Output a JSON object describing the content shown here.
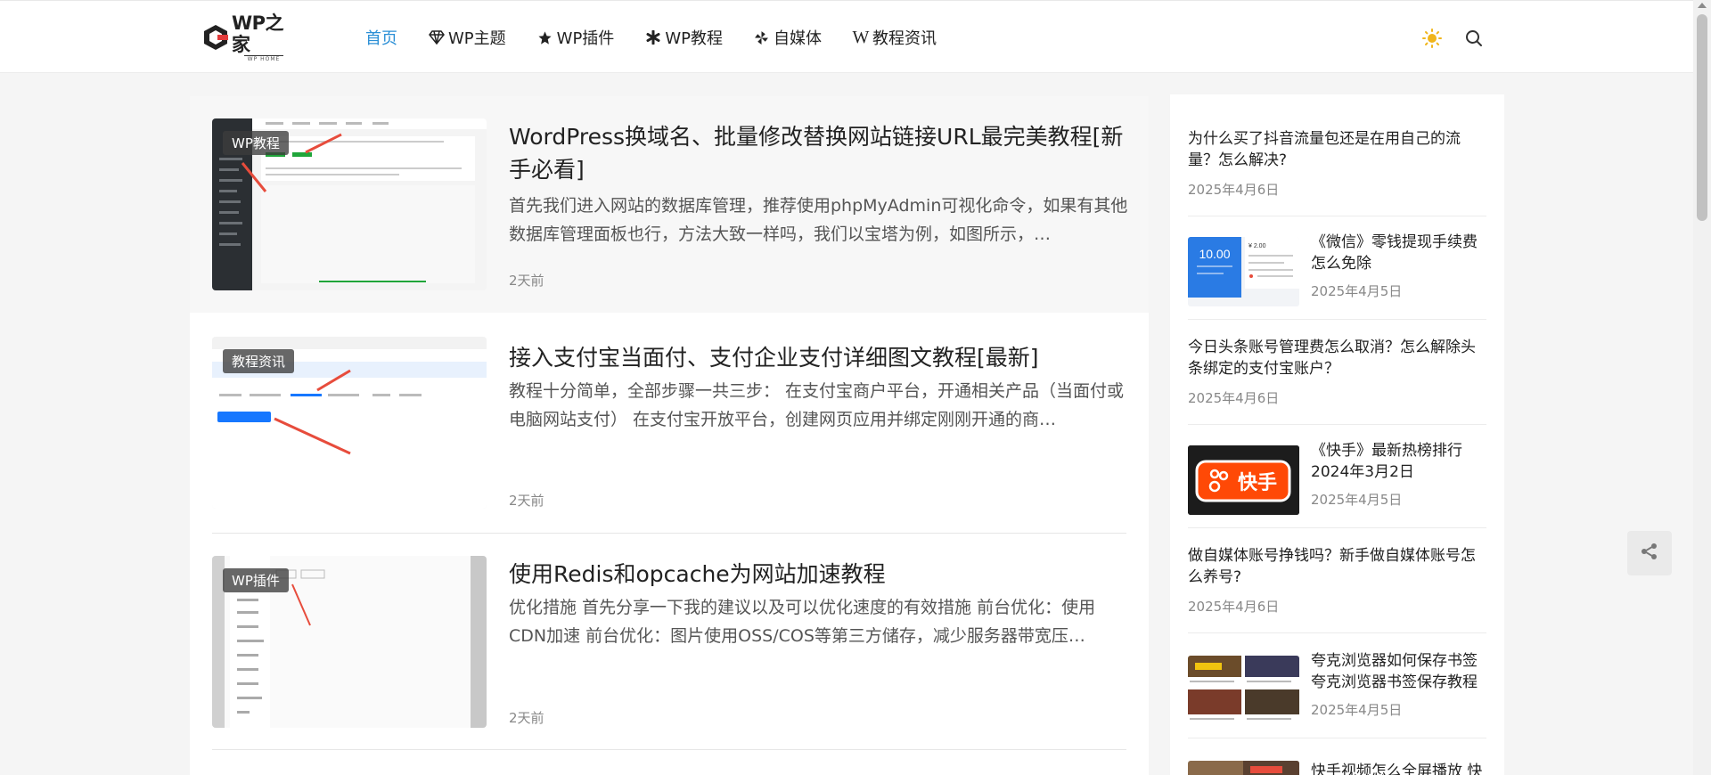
{
  "header": {
    "logo_text": "WP之家",
    "logo_sub": "WP HOME",
    "nav": [
      {
        "label": "首页",
        "icon": "none"
      },
      {
        "label": "WP主题",
        "icon": "diamond-icon"
      },
      {
        "label": "WP插件",
        "icon": "star-icon"
      },
      {
        "label": "WP教程",
        "icon": "asterisk-icon"
      },
      {
        "label": "自媒体",
        "icon": "pinwheel-icon"
      },
      {
        "label": "教程资讯",
        "icon": "wikipedia-w-icon"
      }
    ],
    "accent": "#2b8fd6"
  },
  "posts": [
    {
      "category": "WP教程",
      "title": "WordPress换域名、批量修改替换网站链接URL最完美教程[新手必看]",
      "excerpt": "首先我们进入网站的数据库管理，推荐使用phpMyAdmin可视化命令，如果有其他数据库管理面板也行，方法大致一样吗，我们以宝塔为例，如图所示，…",
      "time": "2天前"
    },
    {
      "category": "教程资讯",
      "title": "接入支付宝当面付、支付企业支付详细图文教程[最新]",
      "excerpt": "教程十分简单，全部步骤一共三步： 在支付宝商户平台，开通相关产品（当面付或电脑网站支付） 在支付宝开放平台，创建网页应用并绑定刚刚开通的商…",
      "time": "2天前"
    },
    {
      "category": "WP插件",
      "title": "使用Redis和opcache为网站加速教程",
      "excerpt": "优化措施 首先分享一下我的建议以及可以优化速度的有效措施 前台优化：使用CDN加速 前台优化：图片使用OSS/COS等第三方储存，减少服务器带宽压…",
      "time": "2天前"
    }
  ],
  "sidebar": [
    {
      "title": "为什么买了抖音流量包还是在用自己的流量？怎么解决?",
      "date": "2025年4月6日",
      "thumb": false
    },
    {
      "title": "《微信》零钱提现手续费怎么免除",
      "date": "2025年4月5日",
      "thumb": true,
      "thumb_amount": "10.00",
      "thumb_right": "¥ 2.00"
    },
    {
      "title": "今日头条账号管理费怎么取消？怎么解除头条绑定的支付宝账户？",
      "date": "2025年4月6日",
      "thumb": false
    },
    {
      "title": "《快手》最新热榜排行2024年3月2日",
      "date": "2025年4月5日",
      "thumb": true,
      "thumb_logo": "快手"
    },
    {
      "title": "做自媒体账号挣钱吗？新手做自媒体账号怎么养号?",
      "date": "2025年4月6日",
      "thumb": false
    },
    {
      "title": "夸克浏览器如何保存书签夸克浏览器书签保存教程",
      "date": "2025年4月5日",
      "thumb": true
    },
    {
      "title": "快手视频怎么全屏播放 快",
      "date": "",
      "thumb": true
    }
  ]
}
